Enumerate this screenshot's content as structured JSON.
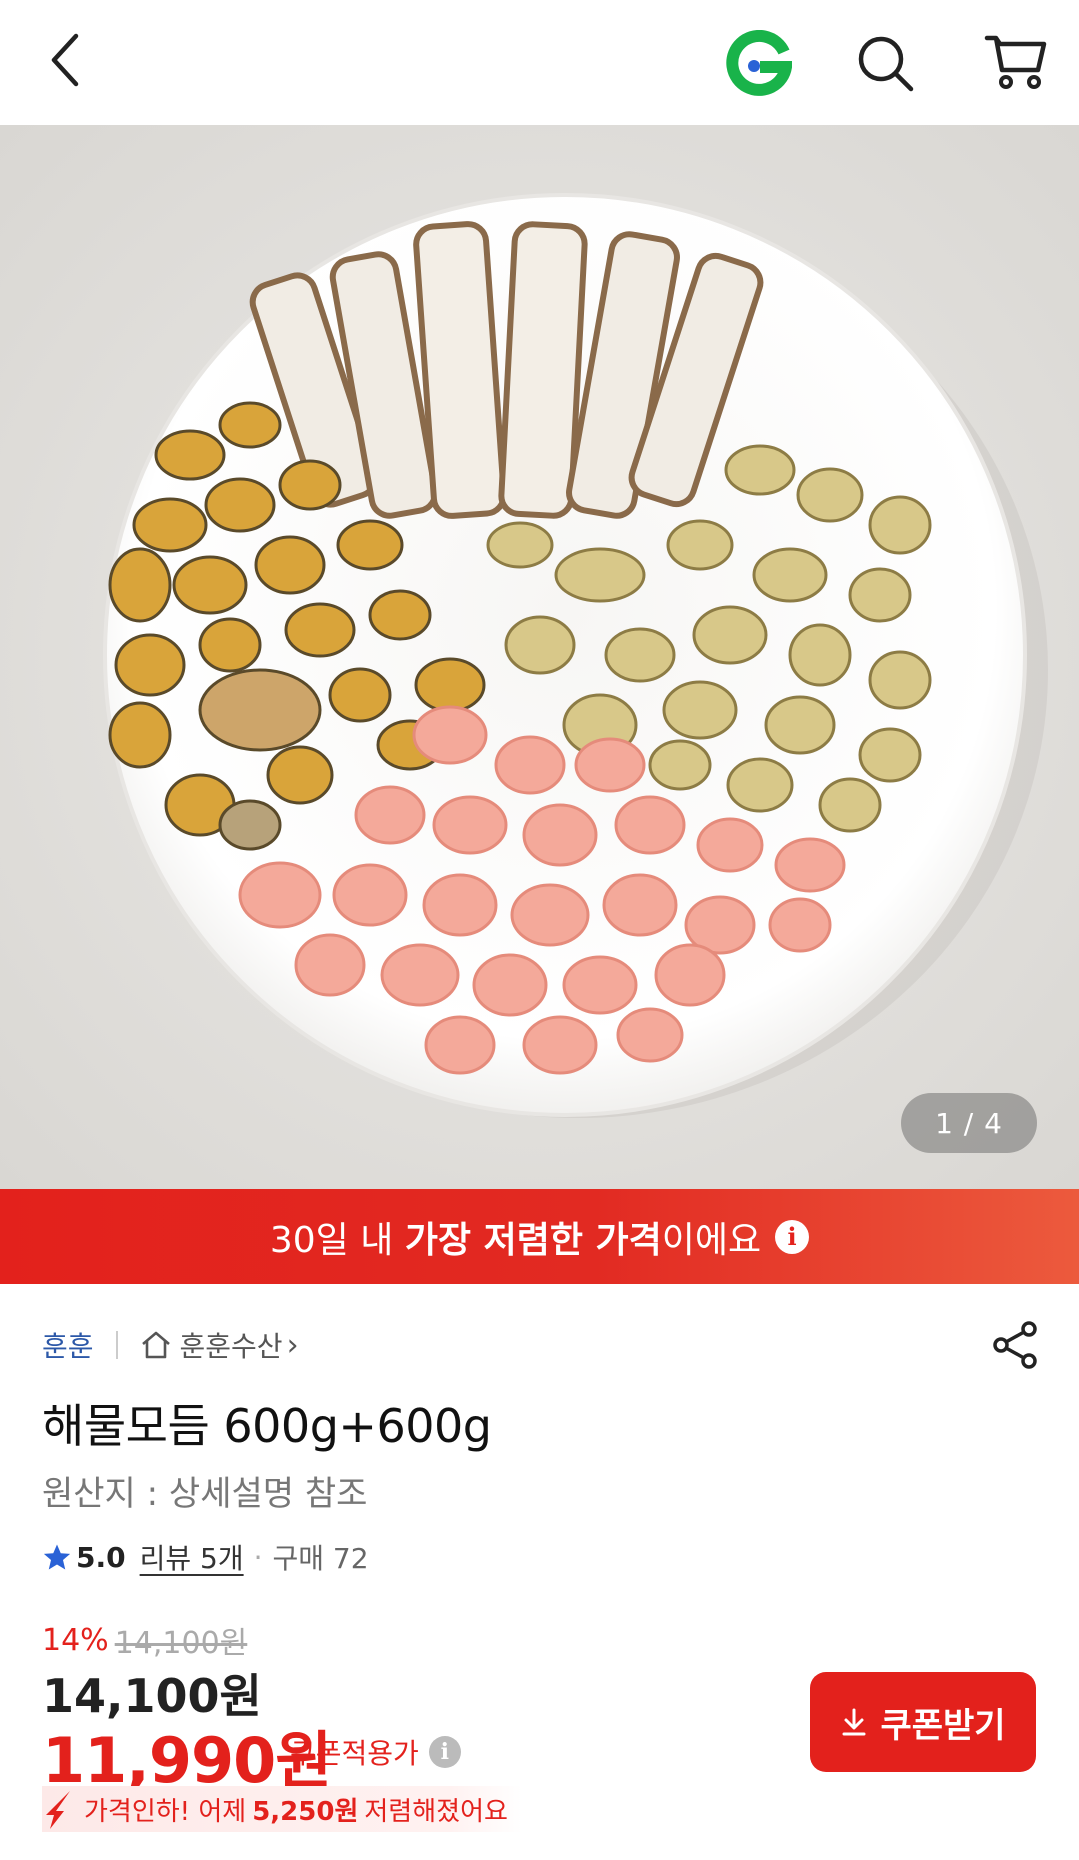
{
  "header": {
    "back_icon": "chevron-left-icon",
    "logo_icon": "g-logo-icon",
    "search_icon": "search-icon",
    "cart_icon": "cart-icon",
    "logo_color": "#19b34a"
  },
  "gallery": {
    "counter": "1 / 4"
  },
  "promo": {
    "text_before": "30일 내 ",
    "text_bold": "가장 저렴한 가격",
    "text_after": "이에요",
    "info_icon": "i",
    "color": "#e3211c"
  },
  "seller": {
    "brand": "훈훈",
    "store": "훈훈수산",
    "store_arrow": "›"
  },
  "product": {
    "title": "해물모듬 600g+600g",
    "origin": "원산지 : 상세설명 참조"
  },
  "rating": {
    "score": "5.0",
    "review_text": "리뷰 5개",
    "separator": "·",
    "purchase_text": "구매 72"
  },
  "price": {
    "discount_rate": "14%",
    "original": "14,100원",
    "current": "14,100원",
    "final": "11,990원",
    "coupon_label": "쿠폰적용가",
    "coupon_info": "i"
  },
  "coupon_button": {
    "label": "쿠폰받기"
  },
  "price_drop": {
    "prefix": "가격인하! 어제",
    "amount": "5,250원",
    "suffix": "저렴해졌어요"
  }
}
